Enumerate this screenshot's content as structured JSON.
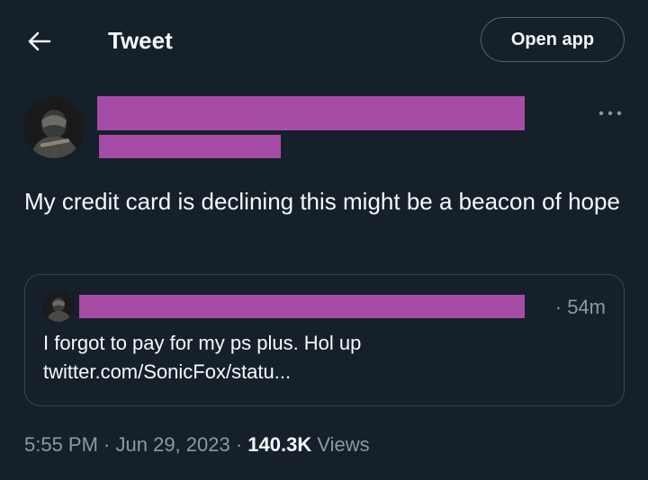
{
  "header": {
    "title": "Tweet",
    "open_app_label": "Open app"
  },
  "tweet": {
    "text": "My credit card is declining this might be a beacon of hope"
  },
  "quoted_tweet": {
    "time": "· 54m",
    "text_line1": "I forgot to pay for my ps plus. Hol up",
    "text_line2": "twitter.com/SonicFox/statu..."
  },
  "meta": {
    "time": "5:55 PM",
    "sep1": " · ",
    "date": "Jun 29, 2023",
    "sep2": " · ",
    "views_count": "140.3K",
    "views_label": " Views"
  },
  "colors": {
    "background": "#15202b",
    "text": "#f7f9f9",
    "secondary_text": "#8b98a5",
    "border": "#38444d",
    "redaction": "#a64ca6"
  },
  "icons": {
    "back": "arrow-left-icon",
    "more": "more-horizontal-icon"
  }
}
